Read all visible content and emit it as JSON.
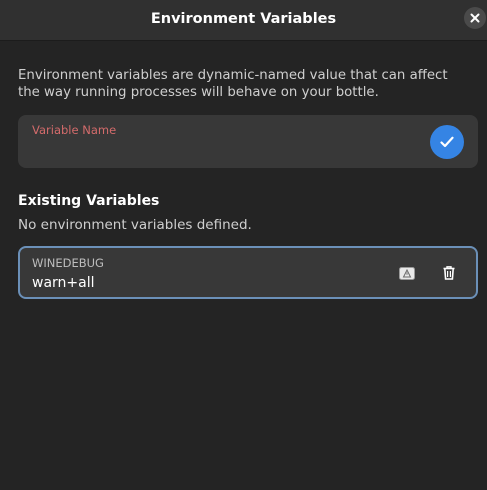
{
  "window": {
    "title": "Environment Variables"
  },
  "description": "Environment variables are dynamic-named value that can affect the way running processes will behave on your bottle.",
  "new_variable": {
    "label": "Variable Name",
    "value": ""
  },
  "existing": {
    "heading": "Existing Variables",
    "empty_message": "No environment variables defined.",
    "items": [
      {
        "name": "WINEDEBUG",
        "value": "warn+all"
      }
    ]
  },
  "colors": {
    "accent": "#3584e4",
    "error_label": "#d36b6b",
    "focus_border": "#6b90b8",
    "background": "#242424",
    "headerbar": "#303030"
  }
}
